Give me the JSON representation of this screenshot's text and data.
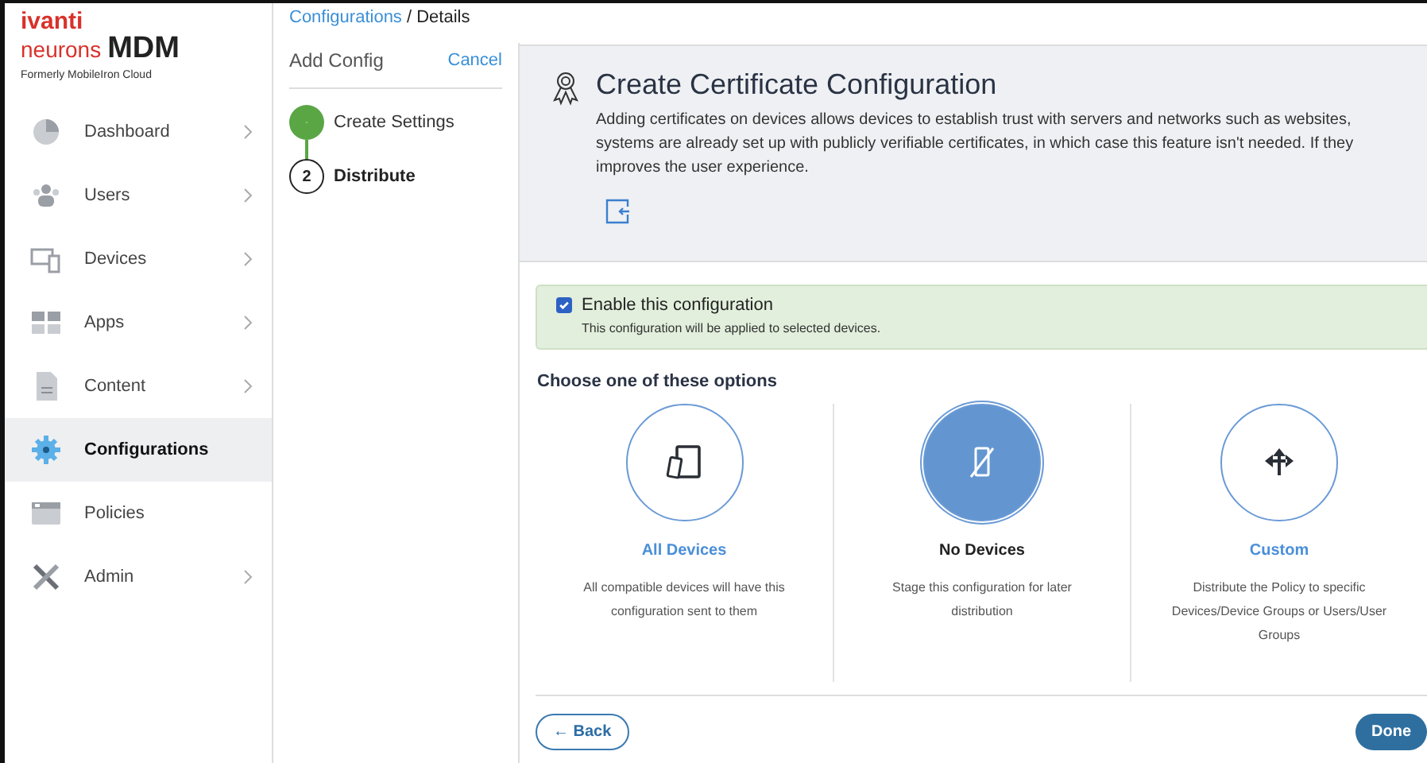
{
  "brand": {
    "logo_top": "ivanti",
    "logo_bottom": "neurons",
    "product": "MDM",
    "subtitle": "Formerly MobileIron Cloud"
  },
  "sidebar": {
    "items": [
      {
        "label": "Dashboard",
        "kind": "pie",
        "chevron": true,
        "selected": false
      },
      {
        "label": "Users",
        "kind": "users",
        "chevron": true,
        "selected": false
      },
      {
        "label": "Devices",
        "kind": "devices",
        "chevron": true,
        "selected": false
      },
      {
        "label": "Apps",
        "kind": "apps",
        "chevron": true,
        "selected": false
      },
      {
        "label": "Content",
        "kind": "doc",
        "chevron": true,
        "selected": false
      },
      {
        "label": "Configurations",
        "kind": "gear",
        "chevron": false,
        "selected": true
      },
      {
        "label": "Policies",
        "kind": "window",
        "chevron": false,
        "selected": false
      },
      {
        "label": "Admin",
        "kind": "tools",
        "chevron": true,
        "selected": false
      }
    ]
  },
  "breadcrumb": {
    "link": "Configurations",
    "current": "/ Details"
  },
  "wizard": {
    "title": "Add Config",
    "cancel": "Cancel",
    "steps": [
      {
        "label": "Create Settings",
        "done": true
      },
      {
        "label": "Distribute",
        "number": "2",
        "done": false
      }
    ]
  },
  "header": {
    "title": "Create Certificate Configuration",
    "lines": [
      "Adding certificates on devices allows devices to establish trust with servers and networks such as websites,",
      "systems are already set up with publicly verifiable certificates, in which case this feature isn't needed. If they",
      "improves the user experience."
    ]
  },
  "enable": {
    "label": "Enable this configuration",
    "checked": true,
    "note": "This configuration will be applied to selected devices."
  },
  "options_heading": "Choose one of these options",
  "options": [
    {
      "kind": "all",
      "title": "All Devices",
      "description": "All compatible devices will have this configuration sent to them",
      "selected": false
    },
    {
      "kind": "none",
      "title": "No Devices",
      "description": "Stage this configuration for later distribution",
      "selected": true
    },
    {
      "kind": "custom",
      "title": "Custom",
      "description": "Distribute the Policy to specific Devices/Device Groups or Users/User Groups",
      "selected": false
    }
  ],
  "footer": {
    "back": "← Back",
    "done": "Done"
  }
}
